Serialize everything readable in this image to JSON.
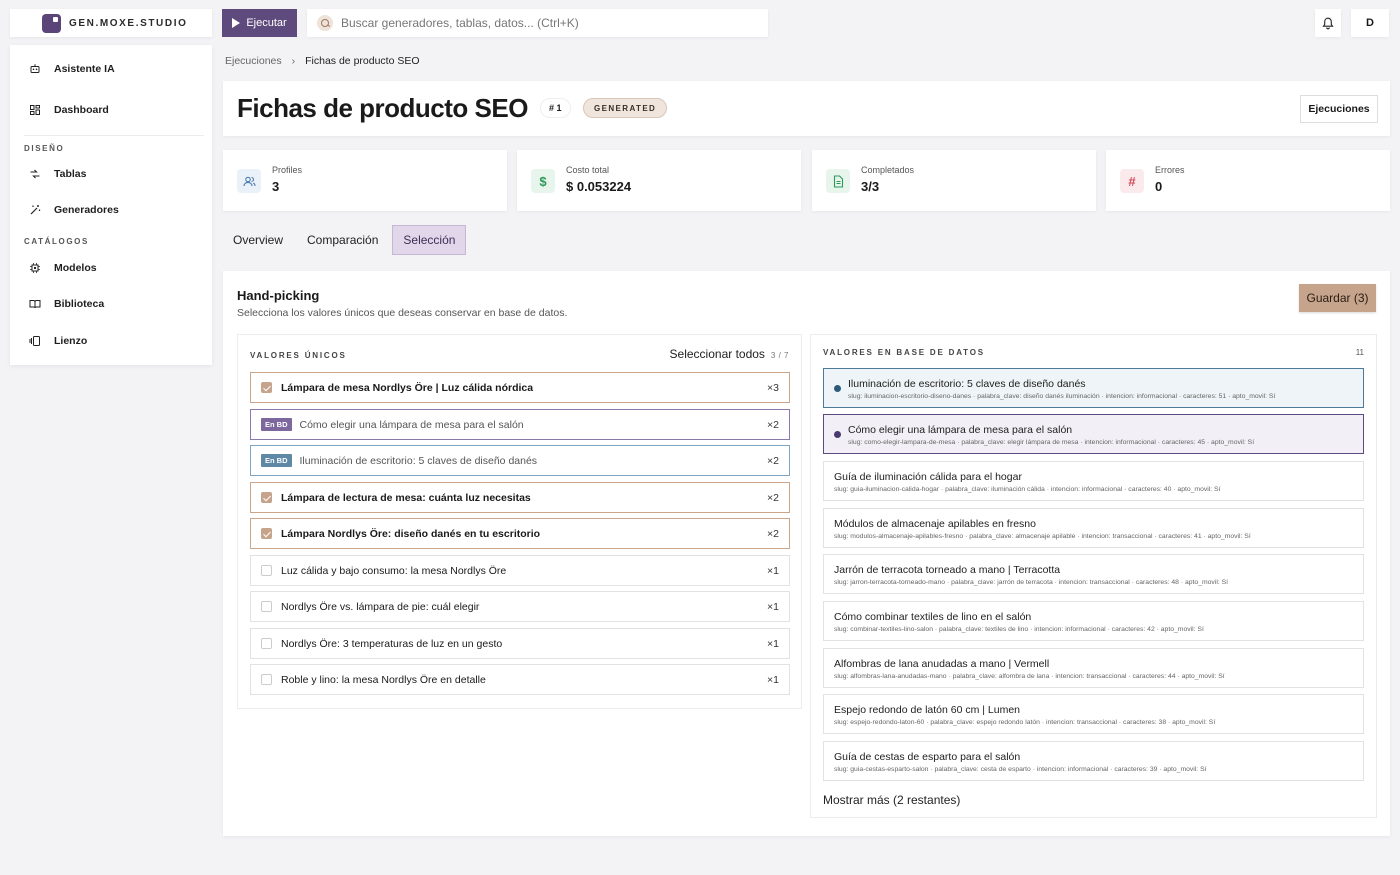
{
  "app": {
    "logo_text": "GEN.MOXE.STUDIO"
  },
  "topbar": {
    "run_label": "Ejecutar",
    "search_placeholder": "Buscar generadores, tablas, datos... (Ctrl+K)",
    "user_initial": "D"
  },
  "sidebar": {
    "items_top": [
      {
        "label": "Asistente IA",
        "icon": "robot-icon"
      },
      {
        "label": "Dashboard",
        "icon": "dashboard-icon"
      }
    ],
    "section_design": "DISEÑO",
    "items_design": [
      {
        "label": "Tablas",
        "icon": "tables-icon"
      },
      {
        "label": "Generadores",
        "icon": "wand-icon"
      }
    ],
    "section_catalogs": "CATÁLOGOS",
    "items_catalogs": [
      {
        "label": "Modelos",
        "icon": "chip-icon"
      },
      {
        "label": "Biblioteca",
        "icon": "book-icon"
      },
      {
        "label": "Lienzo",
        "icon": "canvas-icon"
      }
    ]
  },
  "breadcrumb": {
    "parent": "Ejecuciones",
    "separator": "›",
    "current": "Fichas de producto SEO"
  },
  "header": {
    "title": "Fichas de producto SEO",
    "id_badge": "# 1",
    "status_badge": "GENERATED",
    "runs_button": "Ejecuciones"
  },
  "stats": [
    {
      "label": "Profiles",
      "value": "3",
      "icon": "users-icon",
      "color": "#4a7bb0",
      "bg": "#eaf1f8"
    },
    {
      "label": "Costo total",
      "value": "$ 0.053224",
      "icon": "dollar-icon",
      "color": "#2e9a5a",
      "bg": "#e7f5ec"
    },
    {
      "label": "Completados",
      "value": "3/3",
      "icon": "document-icon",
      "color": "#2e9a5a",
      "bg": "#e7f5ec"
    },
    {
      "label": "Errores",
      "value": "0",
      "icon": "hash-icon",
      "color": "#d04a5a",
      "bg": "#fbeaec"
    }
  ],
  "tabs": [
    {
      "label": "Overview",
      "active": false
    },
    {
      "label": "Comparación",
      "active": false
    },
    {
      "label": "Selección",
      "active": true
    }
  ],
  "handpicking": {
    "title": "Hand-picking",
    "subtitle": "Selecciona los valores únicos que deseas conservar en base de datos.",
    "save_button": "Guardar (3)"
  },
  "unique_values": {
    "header": "VALORES ÚNICOS",
    "select_all": "Seleccionar todos",
    "select_count": "3 / 7",
    "rows": [
      {
        "text": "Lámpara de mesa Nordlys Öre | Luz cálida nórdica",
        "count": "×3",
        "state": "selected"
      },
      {
        "text": "Cómo elegir una lámpara de mesa para el salón",
        "count": "×2",
        "state": "db1",
        "tag": "En BD"
      },
      {
        "text": "Iluminación de escritorio: 5 claves de diseño danés",
        "count": "×2",
        "state": "db2",
        "tag": "En BD"
      },
      {
        "text": "Lámpara de lectura de mesa: cuánta luz necesitas",
        "count": "×2",
        "state": "selected"
      },
      {
        "text": "Lámpara Nordlys Öre: diseño danés en tu escritorio",
        "count": "×2",
        "state": "selected"
      },
      {
        "text": "Luz cálida y bajo consumo: la mesa Nordlys Öre",
        "count": "×1",
        "state": "none"
      },
      {
        "text": "Nordlys Öre vs. lámpara de pie: cuál elegir",
        "count": "×1",
        "state": "none"
      },
      {
        "text": "Nordlys Öre: 3 temperaturas de luz en un gesto",
        "count": "×1",
        "state": "none"
      },
      {
        "text": "Roble y lino: la mesa Nordlys Öre en detalle",
        "count": "×1",
        "state": "none"
      }
    ]
  },
  "db_values": {
    "header": "VALORES EN BASE DE DATOS",
    "count": "11",
    "rows": [
      {
        "title": "Iluminación de escritorio: 5 claves de diseño danés",
        "meta": "slug: iluminacion-escritorio-diseno-danes · palabra_clave: diseño danés iluminación · intencion: informacional · caracteres: 51 · apto_movil: Sí",
        "highlight": "h1"
      },
      {
        "title": "Cómo elegir una lámpara de mesa para el salón",
        "meta": "slug: como-elegir-lampara-de-mesa · palabra_clave: elegir lámpara de mesa · intencion: informacional · caracteres: 45 · apto_movil: Sí",
        "highlight": "h2"
      },
      {
        "title": "Guía de iluminación cálida para el hogar",
        "meta": "slug: guia-iluminacion-calida-hogar · palabra_clave: iluminación cálida · intencion: informacional · caracteres: 40 · apto_movil: Sí",
        "highlight": ""
      },
      {
        "title": "Módulos de almacenaje apilables en fresno",
        "meta": "slug: modulos-almacenaje-apilables-fresno · palabra_clave: almacenaje apilable · intencion: transaccional · caracteres: 41 · apto_movil: Sí",
        "highlight": ""
      },
      {
        "title": "Jarrón de terracota torneado a mano | Terracotta",
        "meta": "slug: jarron-terracota-torneado-mano · palabra_clave: jarrón de terracota · intencion: transaccional · caracteres: 48 · apto_movil: Sí",
        "highlight": ""
      },
      {
        "title": "Cómo combinar textiles de lino en el salón",
        "meta": "slug: combinar-textiles-lino-salon · palabra_clave: textiles de lino · intencion: informacional · caracteres: 42 · apto_movil: Sí",
        "highlight": ""
      },
      {
        "title": "Alfombras de lana anudadas a mano | Vermell",
        "meta": "slug: alfombras-lana-anudadas-mano · palabra_clave: alfombra de lana · intencion: transaccional · caracteres: 44 · apto_movil: Sí",
        "highlight": ""
      },
      {
        "title": "Espejo redondo de latón 60 cm | Lumen",
        "meta": "slug: espejo-redondo-laton-60 · palabra_clave: espejo redondo latón · intencion: transaccional · caracteres: 38 · apto_movil: Sí",
        "highlight": ""
      },
      {
        "title": "Guía de cestas de esparto para el salón",
        "meta": "slug: guia-cestas-esparto-salon · palabra_clave: cesta de esparto · intencion: informacional · caracteres: 39 · apto_movil: Sí",
        "highlight": ""
      }
    ],
    "show_more": "Mostrar más (2 restantes)"
  }
}
